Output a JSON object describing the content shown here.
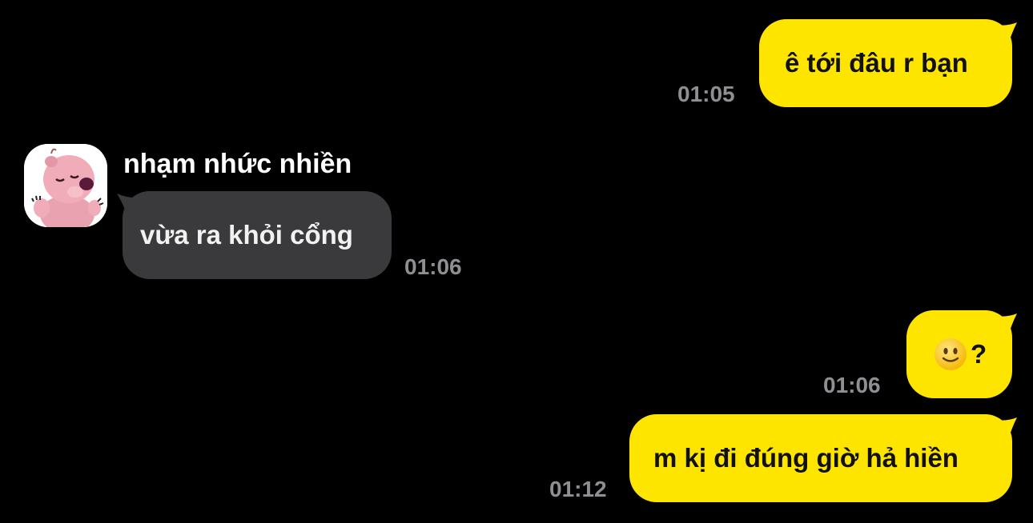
{
  "conversation": {
    "contact_name": "nhạm nhức nhiền",
    "messages": [
      {
        "direction": "outgoing",
        "text": "ê tới đâu r bạn",
        "time": "01:05"
      },
      {
        "direction": "incoming",
        "text": "vừa ra khỏi cổng",
        "time": "01:06"
      },
      {
        "direction": "outgoing",
        "emoji": "slightly-smiling-face-icon",
        "text": "?",
        "time": "01:06"
      },
      {
        "direction": "outgoing",
        "text": "m kị đi đúng giờ hả hiền",
        "time": "01:12"
      }
    ]
  },
  "colors": {
    "background": "#000000",
    "outgoing_bubble": "#FEE500",
    "incoming_bubble": "#3A3A3C",
    "timestamp": "#8E8E93"
  }
}
